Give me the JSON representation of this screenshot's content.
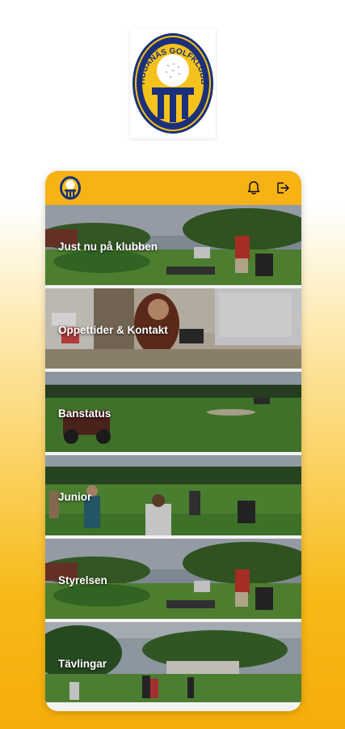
{
  "logo": {
    "text": "HÖGANÄS GOLFKLUBB",
    "colors": {
      "navy": "#1b2f7a",
      "gold": "#f4c21a"
    }
  },
  "header": {
    "icons": [
      "club-logo-icon",
      "bell-icon",
      "logout-icon"
    ],
    "accent": "#f6b313"
  },
  "tiles": [
    {
      "label": "Just nu på klubben"
    },
    {
      "label": "Öppettider & Kontakt"
    },
    {
      "label": "Banstatus"
    },
    {
      "label": "Junior"
    },
    {
      "label": "Styrelsen"
    },
    {
      "label": "Tävlingar"
    }
  ]
}
